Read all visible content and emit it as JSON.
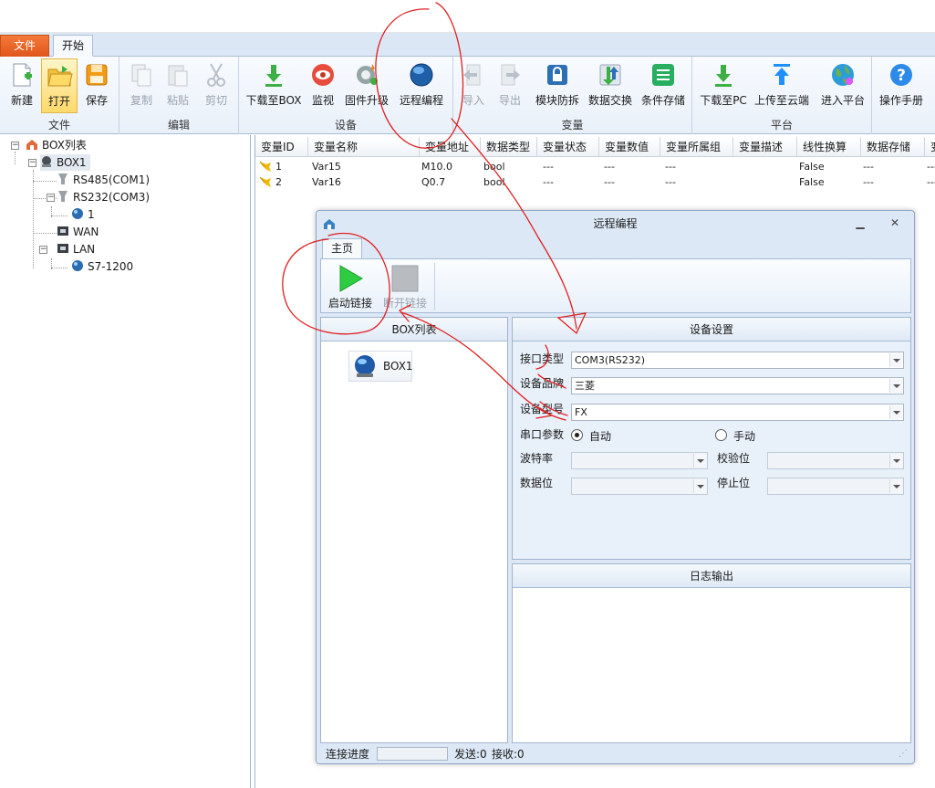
{
  "ribbon_tabs": {
    "file": "文件",
    "start": "开始"
  },
  "ribbon": {
    "groups": {
      "file": "文件",
      "edit": "编辑",
      "device": "设备",
      "variable": "变量",
      "platform": "平台"
    },
    "buttons": {
      "new": "新建",
      "open": "打开",
      "save": "保存",
      "copy": "复制",
      "paste": "粘贴",
      "cut": "剪切",
      "download_box": "下载至BOX",
      "monitor": "监视",
      "firmware": "固件升级",
      "remote": "远程编程",
      "import": "导入",
      "export": "导出",
      "block_protect": "模块防拆",
      "data_exchange": "数据交换",
      "condition_store": "条件存储",
      "download_pc": "下载至PC",
      "upload_cloud": "上传至云端",
      "enter_platform": "进入平台",
      "manual": "操作手册"
    }
  },
  "tree": {
    "root": "BOX列表",
    "box": "BOX1",
    "rs485": "RS485(COM1)",
    "rs232": "RS232(COM3)",
    "rs232_child": "1",
    "wan": "WAN",
    "lan": "LAN",
    "lan_child": "S7-1200"
  },
  "grid": {
    "headers": [
      "变量ID",
      "变量名称",
      "变量地址",
      "数据类型",
      "变量状态",
      "变量数值",
      "变量所属组",
      "变量描述",
      "线性换算",
      "数据存储",
      "变"
    ],
    "rows": [
      {
        "id": "1",
        "name": "Var15",
        "addr": "M10.0",
        "type": "bool",
        "state": "---",
        "value": "---",
        "group": "---",
        "desc": "",
        "linear": "False",
        "store": "---",
        "extra": "---"
      },
      {
        "id": "2",
        "name": "Var16",
        "addr": "Q0.7",
        "type": "bool",
        "state": "---",
        "value": "---",
        "group": "---",
        "desc": "",
        "linear": "False",
        "store": "---",
        "extra": "---"
      }
    ]
  },
  "dialog": {
    "title": "远程编程",
    "tab": "主页",
    "start_link": "启动链接",
    "stop_link": "断开链接",
    "boxlist_title": "BOX列表",
    "box_item": "BOX1",
    "settings_title": "设备设置",
    "port_type_label": "接口类型",
    "port_type_value": "COM3(RS232)",
    "brand_label": "设备品牌",
    "brand_value": "三菱",
    "model_label": "设备型号",
    "model_value": "FX",
    "serial_label": "串口参数",
    "auto_label": "自动",
    "manual_label": "手动",
    "baud_label": "波特率",
    "parity_label": "校验位",
    "databits_label": "数据位",
    "stopbits_label": "停止位",
    "log_title": "日志输出",
    "status_progress_label": "连接进度",
    "status_sent": "发送:0",
    "status_recv": "接收:0"
  },
  "colors": {
    "accent_file_tab": "#e0561a",
    "annotation": "#e02020",
    "play": "#2ecc40"
  }
}
